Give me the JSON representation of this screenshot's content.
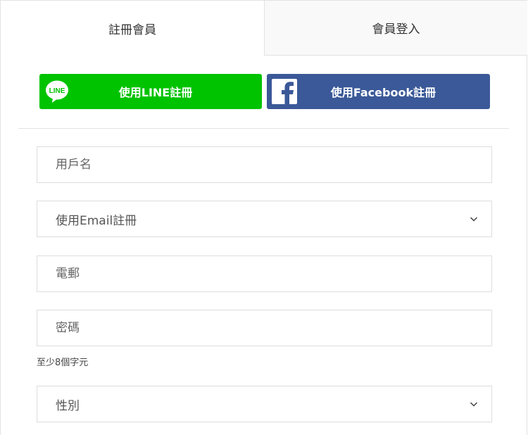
{
  "tabs": {
    "register": "註冊會員",
    "login": "會員登入"
  },
  "social": {
    "line_label": "使用LINE註冊",
    "line_logo_text": "LINE",
    "facebook_label": "使用Facebook註冊",
    "line_color": "#00c300",
    "facebook_color": "#3b5998"
  },
  "form": {
    "username_placeholder": "用戶名",
    "method_selected": "使用Email註冊",
    "email_placeholder": "電郵",
    "password_placeholder": "密碼",
    "password_hint": "至少8個字元",
    "gender_selected": "性別"
  }
}
